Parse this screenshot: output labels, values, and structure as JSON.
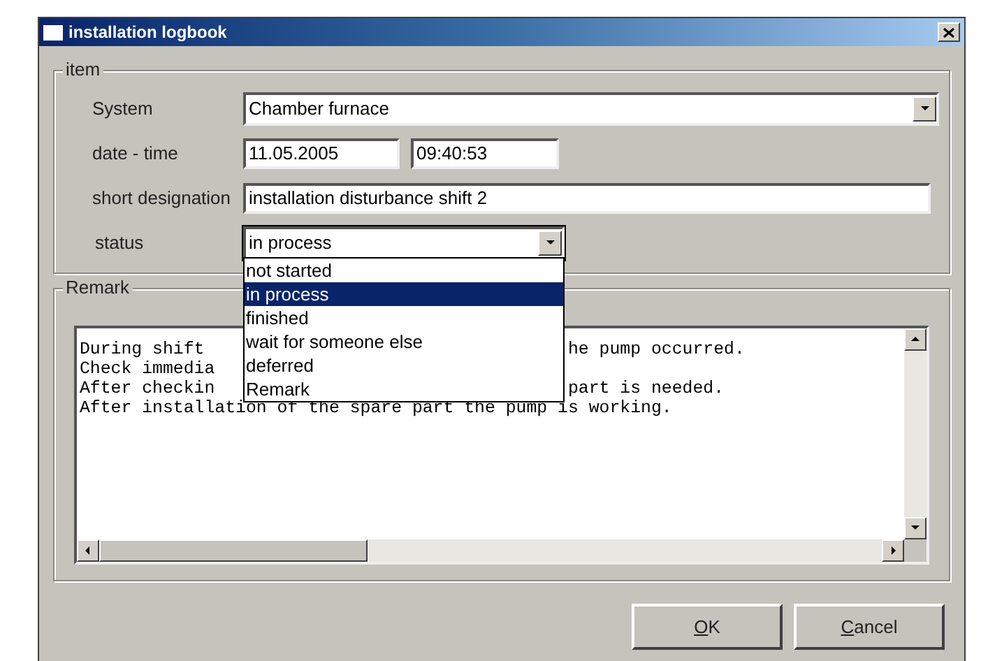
{
  "window": {
    "title": "installation logbook"
  },
  "item_group": {
    "legend": "item",
    "system": {
      "label": "System",
      "value": "Chamber furnace"
    },
    "date_time": {
      "label": "date - time",
      "date": "11.05.2005",
      "time": "09:40:53"
    },
    "short_designation": {
      "label": "short designation",
      "value": "installation disturbance shift 2"
    },
    "status": {
      "label": "status",
      "value": "in process",
      "expanded": true,
      "options": [
        {
          "label": "not started",
          "selected": false
        },
        {
          "label": "in process",
          "selected": true
        },
        {
          "label": "finished",
          "selected": false
        },
        {
          "label": "wait for someone else",
          "selected": false
        },
        {
          "label": "deferred",
          "selected": false
        },
        {
          "label": "Remark",
          "selected": false
        }
      ]
    }
  },
  "remark_group": {
    "legend": "Remark",
    "lines": [
      {
        "left": "During shift ",
        "right": "he pump occurred."
      },
      {
        "left": "Check immedia"
      },
      {
        "left": "After checkin",
        "right": "part is needed."
      },
      {
        "left": "After installation of the spare part the pump is working."
      }
    ]
  },
  "buttons": [
    {
      "label": "OK",
      "underline_first": true
    },
    {
      "label": "Cancel",
      "underline_first": true
    }
  ]
}
